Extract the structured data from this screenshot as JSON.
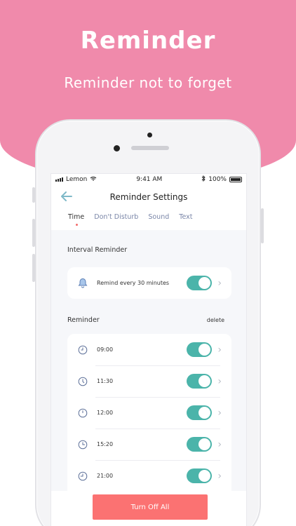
{
  "promo": {
    "title": "Reminder",
    "subtitle": "Reminder not to forget"
  },
  "status_bar": {
    "carrier": "Lemon",
    "time": "9:41 AM",
    "battery": "100%"
  },
  "nav": {
    "title": "Reminder Settings",
    "back_icon": "back-arrow-icon"
  },
  "tabs": [
    {
      "label": "Time",
      "active": true
    },
    {
      "label": "Don't Disturb",
      "active": false
    },
    {
      "label": "Sound",
      "active": false
    },
    {
      "label": "Text",
      "active": false
    }
  ],
  "interval": {
    "section_label": "Interval Reminder",
    "text": "Remind every 30 minutes",
    "enabled": true,
    "icon": "bell-icon"
  },
  "reminders": {
    "section_label": "Reminder",
    "delete_label": "delete",
    "items": [
      {
        "time": "09:00",
        "enabled": true
      },
      {
        "time": "11:30",
        "enabled": true
      },
      {
        "time": "12:00",
        "enabled": true
      },
      {
        "time": "15:20",
        "enabled": true
      },
      {
        "time": "21:00",
        "enabled": true
      }
    ]
  },
  "footer": {
    "button_label": "Turn Off All"
  },
  "colors": {
    "brand_pink": "#F08AAB",
    "toggle_on": "#4BB4AA",
    "button": "#FB7272",
    "back_arrow": "#7FB9C8"
  }
}
